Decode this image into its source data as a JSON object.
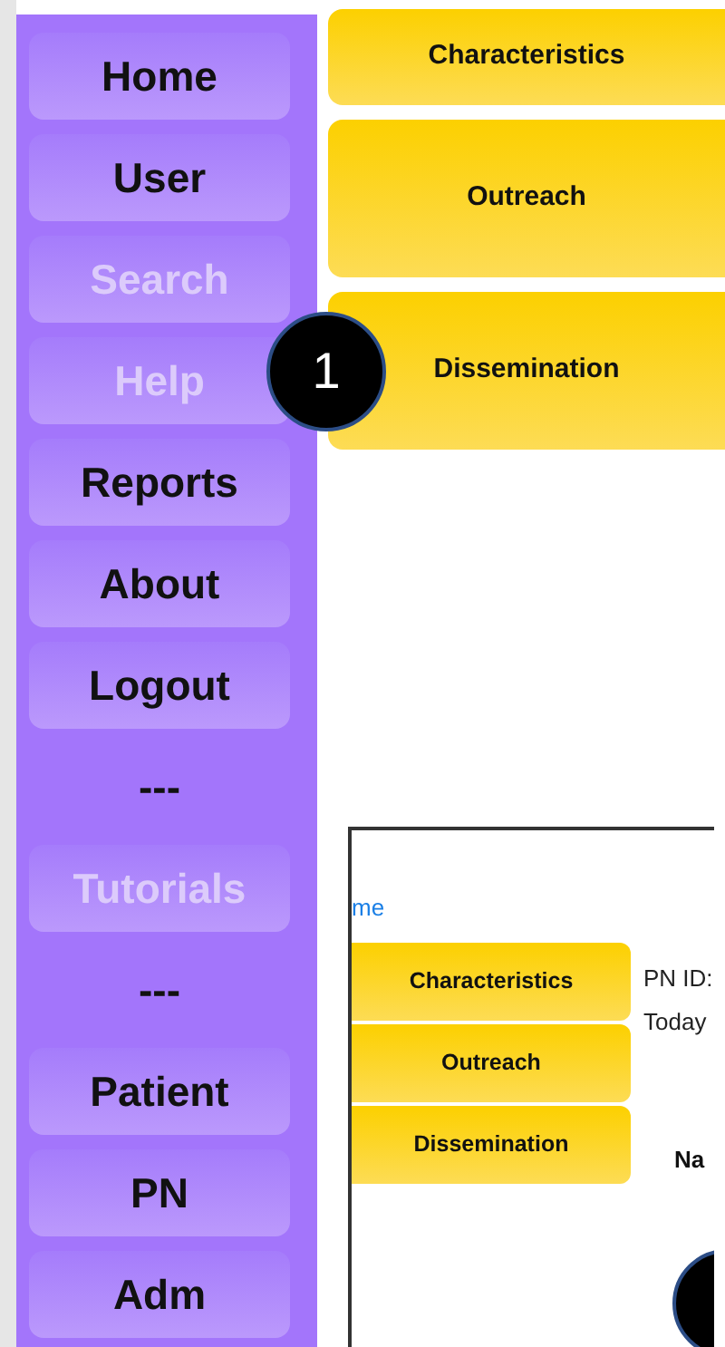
{
  "sidebar": {
    "items": [
      {
        "kind": "button",
        "label": "Home",
        "disabled": false
      },
      {
        "kind": "button",
        "label": "User",
        "disabled": false
      },
      {
        "kind": "button",
        "label": "Search",
        "disabled": true
      },
      {
        "kind": "button",
        "label": "Help",
        "disabled": true
      },
      {
        "kind": "button",
        "label": "Reports",
        "disabled": false
      },
      {
        "kind": "button",
        "label": "About",
        "disabled": false
      },
      {
        "kind": "button",
        "label": "Logout",
        "disabled": false
      },
      {
        "kind": "separator",
        "label": "---"
      },
      {
        "kind": "button",
        "label": "Tutorials",
        "disabled": true
      },
      {
        "kind": "separator",
        "label": "---"
      },
      {
        "kind": "button",
        "label": "Patient",
        "disabled": false
      },
      {
        "kind": "button",
        "label": "PN",
        "disabled": false
      },
      {
        "kind": "button",
        "label": "Adm",
        "disabled": false
      }
    ]
  },
  "main": {
    "buttons": [
      {
        "label": "Characteristics",
        "kind": "short"
      },
      {
        "label": "Outreach",
        "kind": "tall"
      },
      {
        "label": "Dissemination",
        "kind": "tall"
      }
    ]
  },
  "callout": {
    "label": "1"
  },
  "inset": {
    "link": "me",
    "buttons": [
      "Characteristics",
      "Outreach",
      "Dissemination"
    ],
    "info": [
      "PN ID:",
      "Today"
    ],
    "heading": "Na"
  }
}
